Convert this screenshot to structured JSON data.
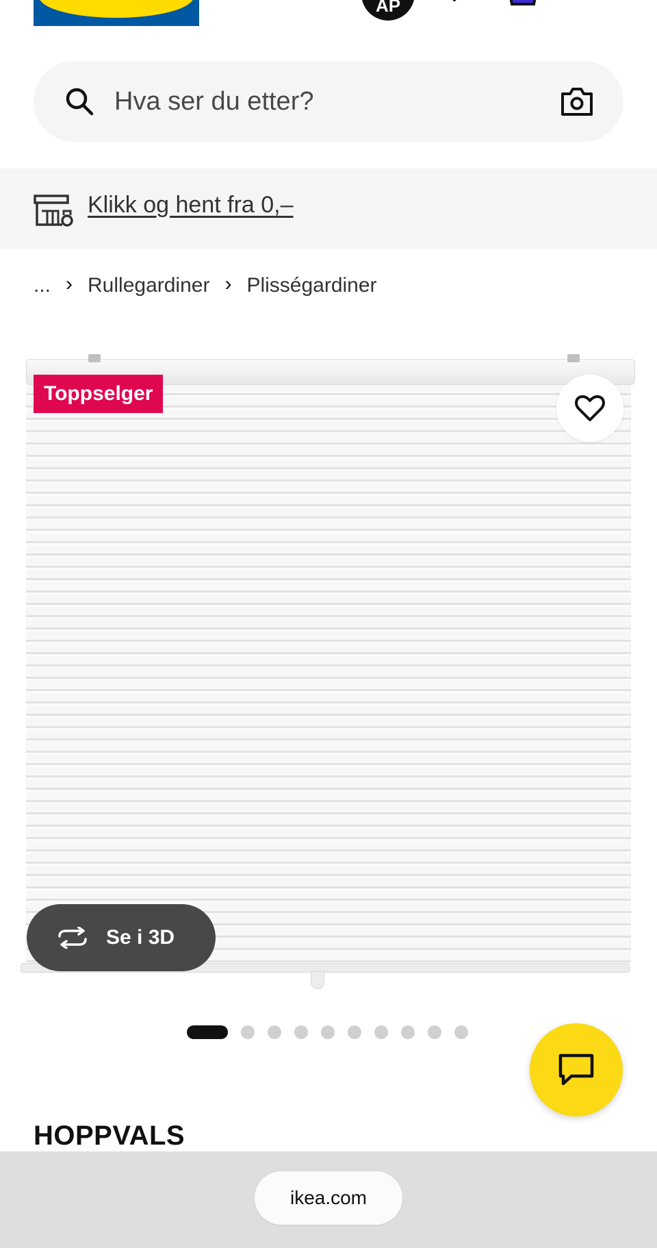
{
  "header": {
    "avatar_initials": "AP",
    "icons": [
      "ikea-logo",
      "heart-icon",
      "shopping-bag-icon",
      "menu-icon"
    ]
  },
  "search": {
    "placeholder": "Hva ser du etter?",
    "value": ""
  },
  "banner": {
    "link_text": "Klikk og hent fra 0,–"
  },
  "breadcrumb": {
    "items": [
      "...",
      "Rullegardiner",
      "Plisségardiner"
    ]
  },
  "product": {
    "badge": "Toppselger",
    "view_3d_label": "Se i 3D",
    "name": "HOPPVALS",
    "image_count": 10,
    "active_image_index": 0
  },
  "browser": {
    "url": "ikea.com"
  },
  "colors": {
    "badge": "#e00751",
    "chat": "#fbd914",
    "logo_blue": "#0058a3",
    "logo_yellow": "#ffdb00"
  }
}
